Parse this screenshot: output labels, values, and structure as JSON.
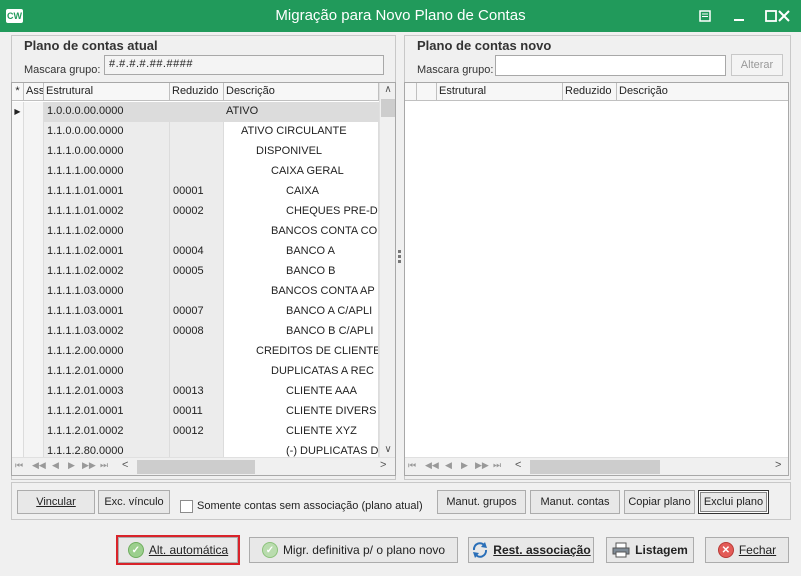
{
  "window": {
    "logo": "CW",
    "title": "Migração para Novo Plano de Contas",
    "controls": [
      "menu-icon",
      "minimize-icon",
      "maximize-icon",
      "close-icon"
    ]
  },
  "left_panel": {
    "title": "Plano de contas atual",
    "mask_label": "Mascara grupo:",
    "mask_value": "#.#.#.#.##.####",
    "columns": [
      "*",
      "Ass",
      "Estrutural",
      "Reduzido",
      "Descrição"
    ],
    "rows": [
      {
        "estrutural": "1.0.0.0.00.0000",
        "reduzido": "",
        "descricao": "ATIVO",
        "level": 0
      },
      {
        "estrutural": "1.1.0.0.00.0000",
        "reduzido": "",
        "descricao": "ATIVO CIRCULANTE",
        "level": 1
      },
      {
        "estrutural": "1.1.1.0.00.0000",
        "reduzido": "",
        "descricao": "DISPONIVEL",
        "level": 2
      },
      {
        "estrutural": "1.1.1.1.00.0000",
        "reduzido": "",
        "descricao": "CAIXA GERAL",
        "level": 3
      },
      {
        "estrutural": "1.1.1.1.01.0001",
        "reduzido": "00001",
        "descricao": "CAIXA",
        "level": 4
      },
      {
        "estrutural": "1.1.1.1.01.0002",
        "reduzido": "00002",
        "descricao": "CHEQUES PRE-D",
        "level": 4
      },
      {
        "estrutural": "1.1.1.1.02.0000",
        "reduzido": "",
        "descricao": "BANCOS CONTA CO",
        "level": 3
      },
      {
        "estrutural": "1.1.1.1.02.0001",
        "reduzido": "00004",
        "descricao": "BANCO A",
        "level": 4
      },
      {
        "estrutural": "1.1.1.1.02.0002",
        "reduzido": "00005",
        "descricao": "BANCO B",
        "level": 4
      },
      {
        "estrutural": "1.1.1.1.03.0000",
        "reduzido": "",
        "descricao": "BANCOS CONTA AP",
        "level": 3
      },
      {
        "estrutural": "1.1.1.1.03.0001",
        "reduzido": "00007",
        "descricao": "BANCO A C/APLI",
        "level": 4
      },
      {
        "estrutural": "1.1.1.1.03.0002",
        "reduzido": "00008",
        "descricao": "BANCO B C/APLI",
        "level": 4
      },
      {
        "estrutural": "1.1.1.2.00.0000",
        "reduzido": "",
        "descricao": "CREDITOS DE CLIENTE",
        "level": 2
      },
      {
        "estrutural": "1.1.1.2.01.0000",
        "reduzido": "",
        "descricao": "DUPLICATAS A REC",
        "level": 3
      },
      {
        "estrutural": "1.1.1.2.01.0003",
        "reduzido": "00013",
        "descricao": "CLIENTE AAA",
        "level": 4
      },
      {
        "estrutural": "1.1.1.2.01.0001",
        "reduzido": "00011",
        "descricao": "CLIENTE DIVERS",
        "level": 4
      },
      {
        "estrutural": "1.1.1.2.01.0002",
        "reduzido": "00012",
        "descricao": "CLIENTE XYZ",
        "level": 4
      },
      {
        "estrutural": "1.1.1.2.80.0000",
        "reduzido": "",
        "descricao": "(-) DUPLICATAS DE",
        "level": 4
      }
    ]
  },
  "right_panel": {
    "title": "Plano de contas novo",
    "mask_label": "Mascara grupo:",
    "mask_value": "",
    "alterar_label": "Alterar",
    "columns": [
      "Estrutural",
      "Reduzido",
      "Descrição"
    ]
  },
  "action_bar": {
    "vincular": "Vincular",
    "exc_vinculo": "Exc. vínculo",
    "checkbox_label": "Somente contas sem associação (plano atual)",
    "checkbox_checked": false,
    "manut_grupos": "Manut. grupos",
    "manut_contas": "Manut. contas",
    "copiar_plano": "Copiar plano",
    "exclui_plano": "Exclui plano"
  },
  "footer": {
    "alt_automatica": "Alt. automática",
    "migr_definitiva": "Migr. definitiva p/ o plano novo",
    "rest_associacao": "Rest. associação",
    "listagem": "Listagem",
    "fechar": "Fechar"
  },
  "colors": {
    "titlebar": "#219a5b",
    "highlight": "#d9232a"
  }
}
